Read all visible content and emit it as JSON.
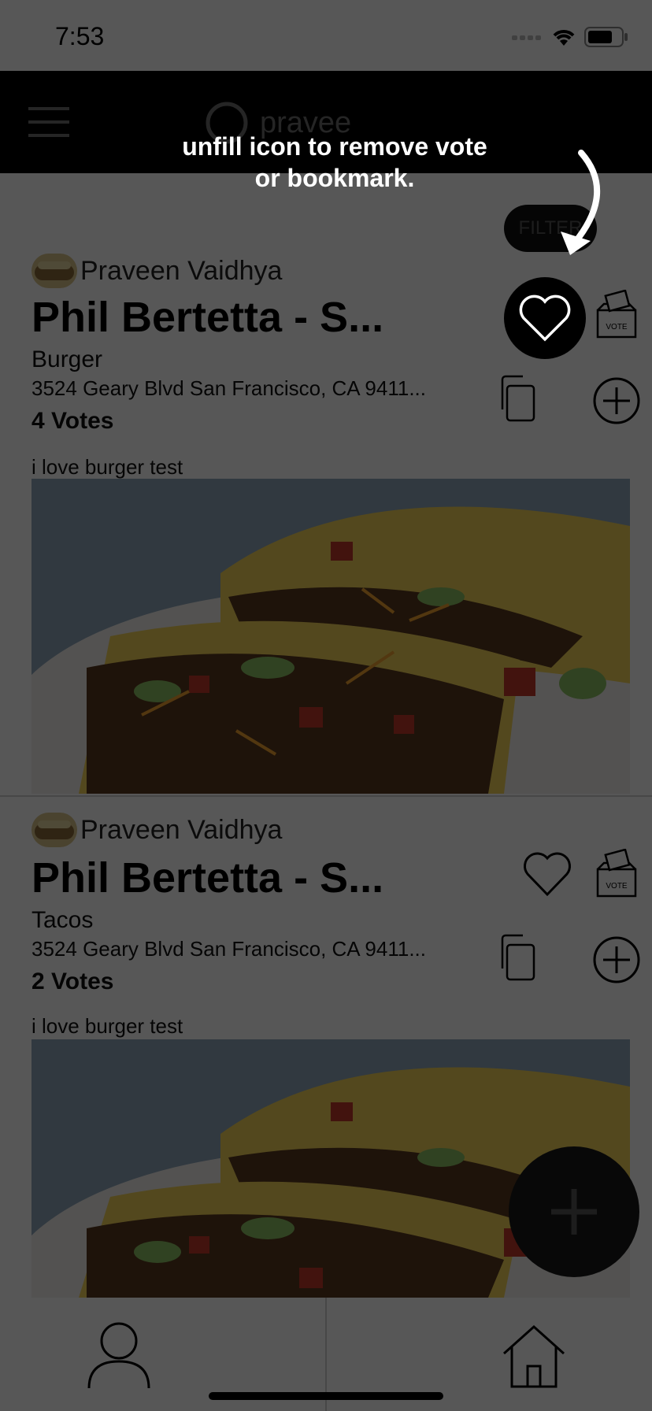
{
  "status": {
    "time": "7:53"
  },
  "header": {
    "search_text": "pravee"
  },
  "filter": {
    "label": "FILTER"
  },
  "posts": [
    {
      "author": "Praveen Vaidhya",
      "restaurant": "Phil Bertetta - S...",
      "cuisine": "Burger",
      "address": "3524 Geary Blvd San Francisco, CA 9411...",
      "votes": "4 Votes",
      "description": "i love burger test",
      "liked": true
    },
    {
      "author": "Praveen Vaidhya",
      "restaurant": "Phil Bertetta - S...",
      "cuisine": "Tacos",
      "address": "3524 Geary Blvd San Francisco, CA 9411...",
      "votes": "2 Votes",
      "description": "i love burger test",
      "liked": false
    }
  ],
  "vote_icon_label": "VOTE",
  "tutorial": {
    "tip": "unfill icon to remove vote or bookmark."
  },
  "tabs": [
    {
      "icon": "profile-icon"
    },
    {
      "icon": "home-icon"
    }
  ],
  "colors": {
    "overlay": "#000000",
    "accent": "#000000"
  }
}
